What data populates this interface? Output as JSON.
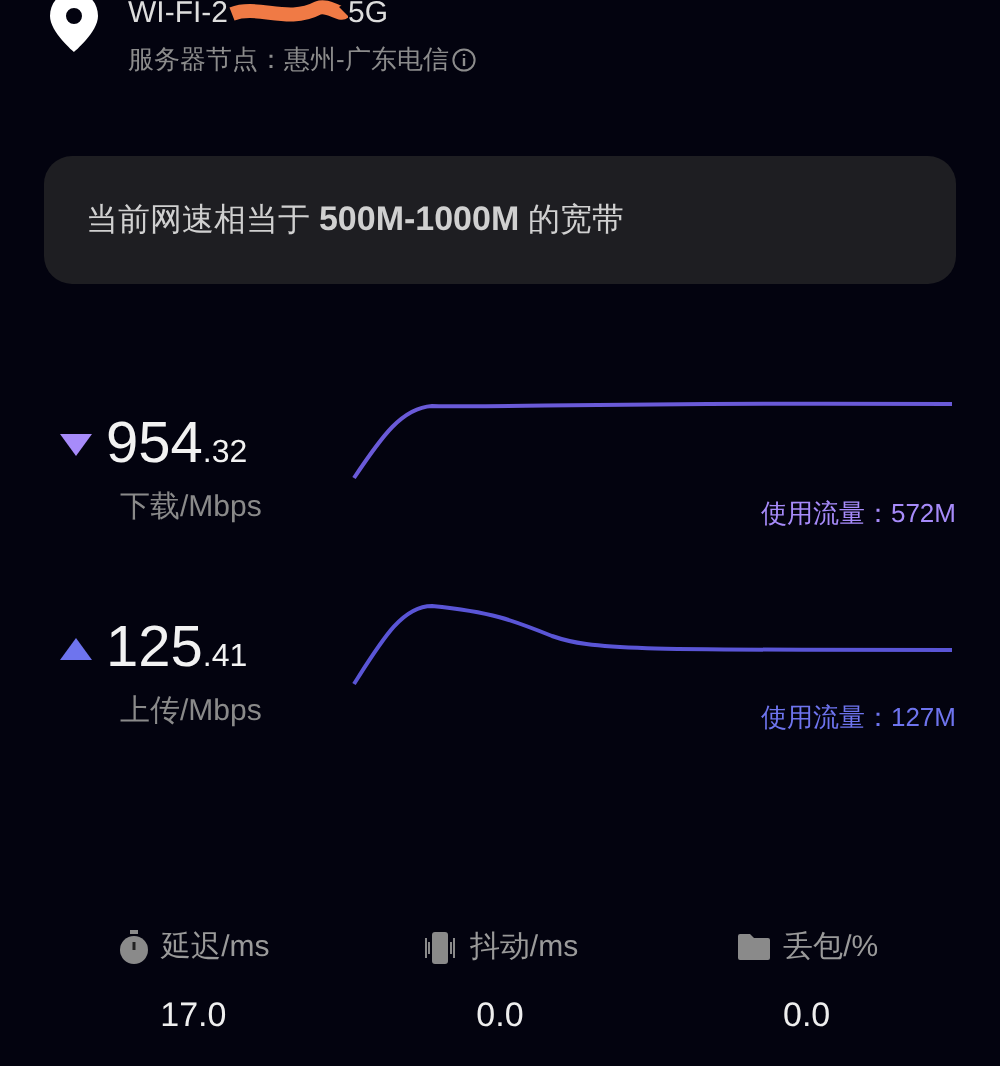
{
  "header": {
    "title_start": "WI-FI-2",
    "title_end": "5G",
    "server": "服务器节点：惠州-广东电信"
  },
  "summary": "当前网速相当于 **500M-1000M** 的宽带",
  "speeds": [
    {
      "kind": "download",
      "value": "954",
      "decimals": ".32",
      "unit": "下载/Mbps",
      "traffic": "使用流量：572M",
      "color": "#a78bfa"
    },
    {
      "kind": "upload",
      "value": "125",
      "decimals": ".41",
      "unit": "上传/Mbps",
      "traffic": "使用流量：127M",
      "color": "#6e74ee"
    }
  ],
  "stats": [
    {
      "kind": "latency",
      "label": "延迟/ms",
      "value": "17.0"
    },
    {
      "kind": "jitter",
      "label": "抖动/ms",
      "value": "0.0"
    },
    {
      "kind": "loss",
      "label": "丢包/%",
      "value": "0.0"
    }
  ]
}
